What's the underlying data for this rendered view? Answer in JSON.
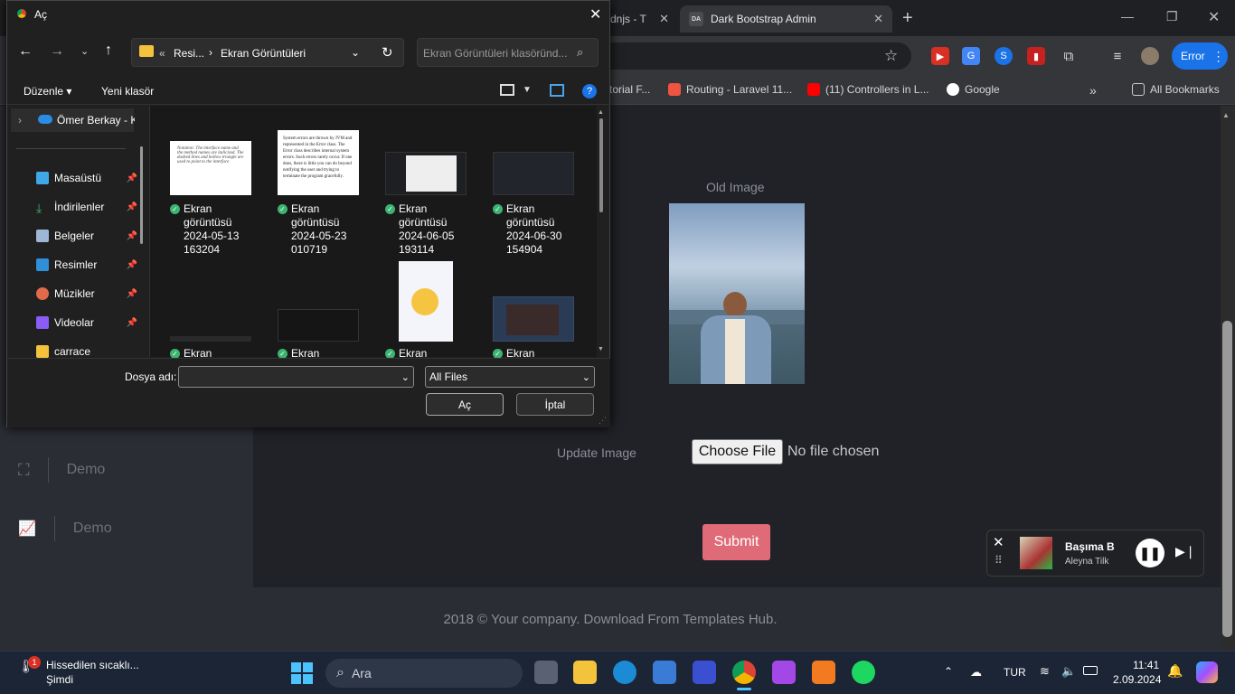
{
  "browser": {
    "tabs": [
      {
        "fav": "",
        "label": "dnjs - T"
      },
      {
        "fav": "DA",
        "label": "Dark Bootstrap Admin"
      }
    ],
    "new_tab": "+",
    "error_label": "Error",
    "bookmarks": [
      "torial F...",
      "Routing - Laravel 11...",
      "(11) Controllers in L...",
      "Google"
    ],
    "all_bookmarks": "All Bookmarks"
  },
  "page": {
    "old_image_label": "Old Image",
    "update_image_label": "Update Image",
    "choose_file": "Choose File",
    "no_file": "No file chosen",
    "submit": "Submit",
    "sidebar_items": [
      "Demo",
      "Demo"
    ],
    "footer": "2018 © Your company. Download From Templates Hub."
  },
  "media": {
    "title": "Başıma B",
    "artist": "Aleyna Tilk"
  },
  "dialog": {
    "title": "Aç",
    "path": [
      "Resi...",
      "Ekran Görüntüleri"
    ],
    "search_placeholder": "Ekran Görüntüleri klasöründ...",
    "organize": "Düzenle",
    "new_folder": "Yeni klasör",
    "onedrive": "Ömer Berkay - K",
    "nav": [
      "Masaüstü",
      "İndirilenler",
      "Belgeler",
      "Resimler",
      "Müzikler",
      "Videolar",
      "carrace"
    ],
    "files_row1": [
      {
        "name": "Ekran",
        "line2": "görüntüsü",
        "line3": "2024-05-13",
        "line4": "163204"
      },
      {
        "name": "Ekran",
        "line2": "görüntüsü",
        "line3": "2024-05-23",
        "line4": "010719"
      },
      {
        "name": "Ekran",
        "line2": "görüntüsü",
        "line3": "2024-06-05",
        "line4": "193114"
      },
      {
        "name": "Ekran",
        "line2": "görüntüsü",
        "line3": "2024-06-30",
        "line4": "154904"
      }
    ],
    "files_row2": [
      "Ekran",
      "Ekran",
      "Ekran",
      "Ekran"
    ],
    "thumb1_text": "Notation: The interface name and the method names are italicized. The dashed lines and hollow triangle are used to point to the interface",
    "thumb2_text": "System errors are thrown by JVM and represented in the Error class. The Error class describes internal system errors. Such errors rarely occur. If one does, there is little you can do beyond notifying the user and trying to terminate the program gracefully.",
    "filename_label": "Dosya adı:",
    "filename_value": "",
    "filter": "All Files",
    "open": "Aç",
    "cancel": "İptal"
  },
  "taskbar": {
    "weather": "Hissedilen sıcaklı...",
    "weather_sub": "Şimdi",
    "weather_badge": "1",
    "search": "Ara",
    "lang": "TUR",
    "time": "11:41",
    "date": "2.09.2024"
  }
}
